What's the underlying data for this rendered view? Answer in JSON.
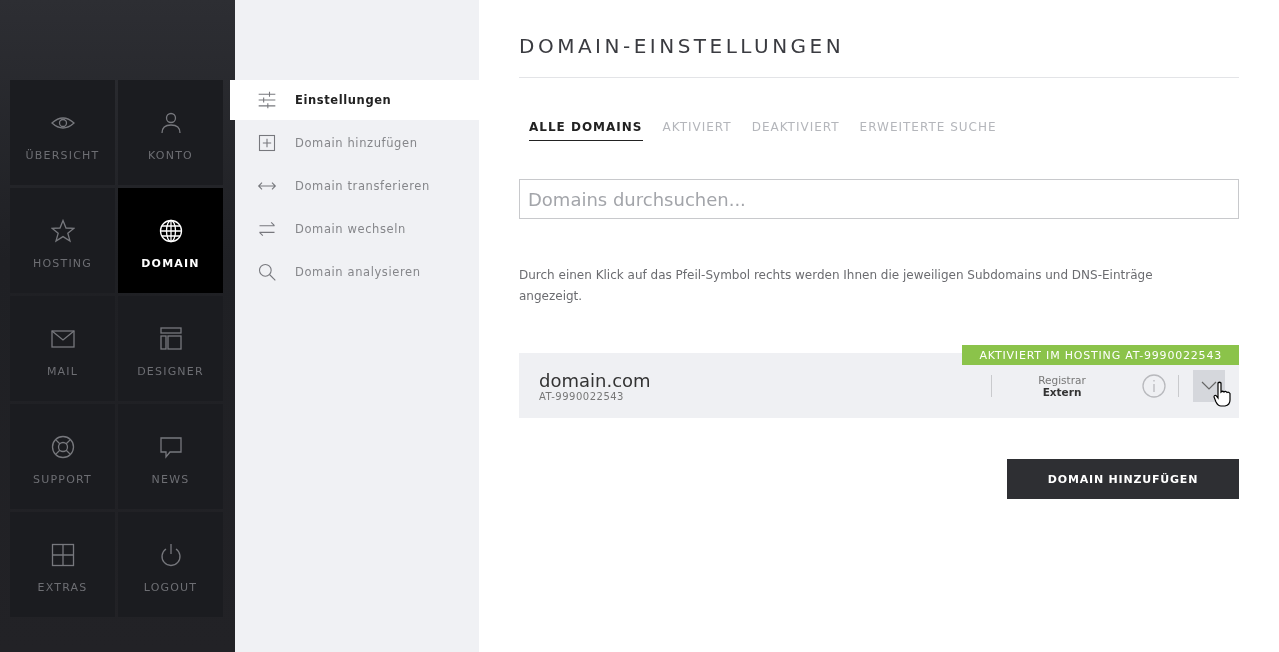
{
  "nav": {
    "tiles": [
      {
        "label": "ÜBERSICHT",
        "selected": false
      },
      {
        "label": "KONTO",
        "selected": false
      },
      {
        "label": "HOSTING",
        "selected": false
      },
      {
        "label": "DOMAIN",
        "selected": true
      },
      {
        "label": "MAIL",
        "selected": false
      },
      {
        "label": "DESIGNER",
        "selected": false
      },
      {
        "label": "SUPPORT",
        "selected": false
      },
      {
        "label": "NEWS",
        "selected": false
      },
      {
        "label": "EXTRAS",
        "selected": false
      },
      {
        "label": "LOGOUT",
        "selected": false
      }
    ]
  },
  "subnav": {
    "items": [
      {
        "label": "Einstellungen",
        "selected": true
      },
      {
        "label": "Domain hinzufügen",
        "selected": false
      },
      {
        "label": "Domain transferieren",
        "selected": false
      },
      {
        "label": "Domain wechseln",
        "selected": false
      },
      {
        "label": "Domain analysieren",
        "selected": false
      }
    ]
  },
  "page": {
    "title": "DOMAIN-EINSTELLUNGEN",
    "tabs": [
      {
        "label": "ALLE DOMAINS",
        "selected": true
      },
      {
        "label": "AKTIVIERT",
        "selected": false
      },
      {
        "label": "DEAKTIVIERT",
        "selected": false
      },
      {
        "label": "ERWEITERTE SUCHE",
        "selected": false
      }
    ],
    "search": {
      "placeholder": "Domains durchsuchen..."
    },
    "hint": "Durch einen Klick auf das Pfeil-Symbol rechts werden Ihnen die jeweiligen Subdomains und DNS-Einträge angezeigt.",
    "domains": [
      {
        "name": "domain.com",
        "id": "AT-9990022543",
        "badge": "AKTIVIERT IM HOSTING AT-9990022543",
        "registrar_label": "Registrar",
        "registrar": "Extern"
      }
    ],
    "add_button": "DOMAIN HINZUFÜGEN"
  }
}
